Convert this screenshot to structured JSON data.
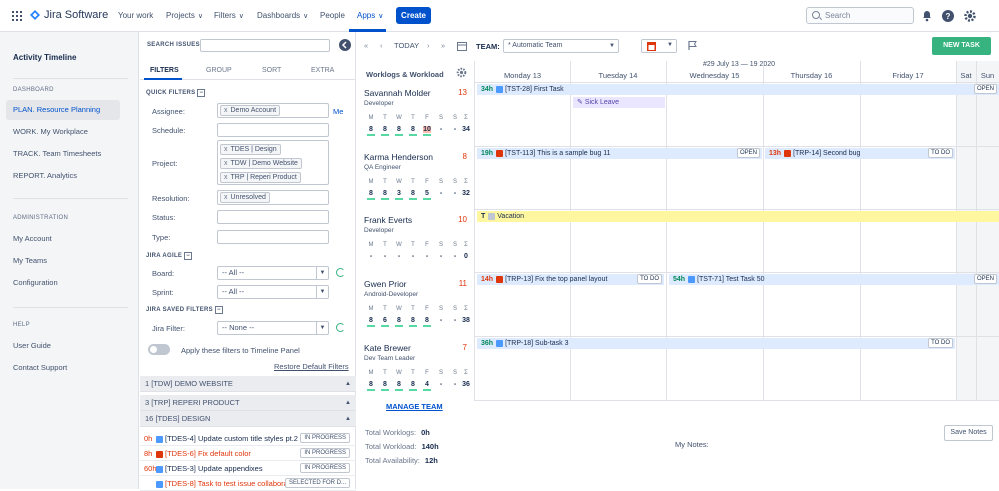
{
  "topnav": {
    "logo": "Jira Software",
    "items": [
      {
        "label": "Your work",
        "has_caret": false
      },
      {
        "label": "Projects",
        "has_caret": true
      },
      {
        "label": "Filters",
        "has_caret": true
      },
      {
        "label": "Dashboards",
        "has_caret": true
      },
      {
        "label": "People",
        "has_caret": false
      },
      {
        "label": "Apps",
        "has_caret": true
      }
    ],
    "caret": "∨",
    "create_label": "Create",
    "search_placeholder": "Search",
    "accent": "#0052cc"
  },
  "sidebar": {
    "title": "Activity Timeline",
    "sections": [
      {
        "header": "DASHBOARD",
        "items": [
          "PLAN. Resource Planning",
          "WORK. My Workplace",
          "TRACK. Team Timesheets",
          "REPORT. Analytics"
        ]
      },
      {
        "header": "ADMINISTRATION",
        "items": [
          "My Account",
          "My Teams",
          "Configuration"
        ]
      },
      {
        "header": "HELP",
        "items": [
          "User Guide",
          "Contact Support"
        ]
      }
    ],
    "selected": "PLAN. Resource Planning"
  },
  "filters": {
    "search_label": "SEARCH ISSUES:",
    "tabs": [
      "FILTERS",
      "GROUP",
      "SORT",
      "EXTRA"
    ],
    "quick_filters_header": "QUICK FILTERS",
    "assignee_label": "Assignee:",
    "assignee_chip": "Demo Account",
    "me_link": "Me",
    "schedule_label": "Schedule:",
    "project_label": "Project:",
    "project_chips": [
      "TDES | Design",
      "TDW | Demo Website",
      "TRP | Reperi Product"
    ],
    "resolution_label": "Resolution:",
    "resolution_chip": "Unresolved",
    "status_label": "Status:",
    "type_label": "Type:",
    "jira_agile_header": "JIRA AGILE",
    "board_label": "Board:",
    "board_value": "-- All --",
    "sprint_label": "Sprint:",
    "sprint_value": "-- All --",
    "saved_filters_header": "JIRA SAVED FILTERS",
    "jira_filter_label": "Jira Filter:",
    "jira_filter_value": "-- None --",
    "apply_toggle_label": "Apply these filters to Timeline Panel",
    "restore_link": "Restore Default Filters",
    "remove_mark": "x",
    "collapse_mark": "−"
  },
  "projects": [
    {
      "count": "1",
      "label": "[TDW] DEMO WEBSITE"
    },
    {
      "count": "3",
      "label": "[TRP] REPERI PRODUCT"
    },
    {
      "count": "16",
      "label": "[TDES] DESIGN"
    }
  ],
  "tasks": [
    {
      "hours": "0h",
      "key": "[TDES-4]",
      "title": "Update custom title styles pt.2",
      "status": "IN PROGRESS",
      "type": "blue",
      "red": false
    },
    {
      "hours": "8h",
      "key": "[TDES-6]",
      "title": "Fix default color",
      "status": "IN PROGRESS",
      "type": "red",
      "red": true
    },
    {
      "hours": "60h",
      "key": "[TDES-3]",
      "title": "Update appendixes",
      "status": "IN PROGRESS",
      "type": "blue",
      "red": false
    },
    {
      "hours": "",
      "key": "[TDES-8]",
      "title": "Task to test issue collaborat...",
      "status": "SELECTED FOR D...",
      "type": "blue",
      "red": true
    }
  ],
  "toolbar": {
    "today": "TODAY",
    "team_label": "TEAM:",
    "team_value": "* Automatic Team",
    "new_task": "NEW TASK"
  },
  "calendar": {
    "week_label": "#29 July 13 — 19 2020",
    "worklogs_header": "Worklogs & Workload",
    "days": [
      "Monday 13",
      "Tuesday 14",
      "Wednesday 15",
      "Thursday 16",
      "Friday 17",
      "Sat",
      "Sun"
    ],
    "day_letters": [
      "M",
      "T",
      "W",
      "T",
      "F",
      "S",
      "S",
      "Σ"
    ]
  },
  "users": [
    {
      "name": "Savannah Molder",
      "role": "Developer",
      "count": "13",
      "hours": [
        "8",
        "8",
        "8",
        "8",
        "10",
        "-",
        "-",
        "34"
      ]
    },
    {
      "name": "Karma Henderson",
      "role": "QA Engineer",
      "count": "8",
      "hours": [
        "8",
        "8",
        "3",
        "8",
        "5",
        "-",
        "-",
        "32"
      ]
    },
    {
      "name": "Frank Everts",
      "role": "Developer",
      "count": "10",
      "hours": [
        "-",
        "-",
        "-",
        "-",
        "-",
        "-",
        "-",
        "0"
      ]
    },
    {
      "name": "Gwen Prior",
      "role": "Android-Developer",
      "count": "11",
      "hours": [
        "8",
        "6",
        "8",
        "8",
        "8",
        "-",
        "-",
        "38"
      ]
    },
    {
      "name": "Kate Brewer",
      "role": "Dev Team Leader",
      "count": "7",
      "hours": [
        "8",
        "8",
        "8",
        "8",
        "4",
        "-",
        "-",
        "36"
      ]
    }
  ],
  "events": {
    "e1": {
      "hours": "34h",
      "key": "[TST-28]",
      "title": "First Task",
      "status": "OPEN"
    },
    "e2": {
      "title": "Sick Leave"
    },
    "e3": {
      "hours": "19h",
      "key": "[TST-113]",
      "title": "This is a sample bug 11",
      "status": "OPEN"
    },
    "e4": {
      "hours": "13h",
      "key": "[TRP-14]",
      "title": "Second bug",
      "status": "TO DO"
    },
    "e5": {
      "hours": "T",
      "title": "Vacation"
    },
    "e6": {
      "hours": "14h",
      "key": "[TRP-13]",
      "title": "Fix the top panel layout",
      "status": "TO DO"
    },
    "e7": {
      "hours": "54h",
      "key": "[TST-71]",
      "title": "Test Task 50",
      "status": "OPEN"
    },
    "e8": {
      "hours": "36h",
      "key": "[TRP-18]",
      "title": "Sub-task 3",
      "status": "TO DO"
    }
  },
  "footer": {
    "manage_team": "MANAGE TEAM",
    "total_worklogs_label": "Total Worklogs:",
    "total_worklogs": "0h",
    "total_workload_label": "Total Workload:",
    "total_workload": "140h",
    "total_availability_label": "Total Availability:",
    "total_availability": "12h",
    "my_notes": "My Notes:",
    "save_notes": "Save Notes"
  }
}
